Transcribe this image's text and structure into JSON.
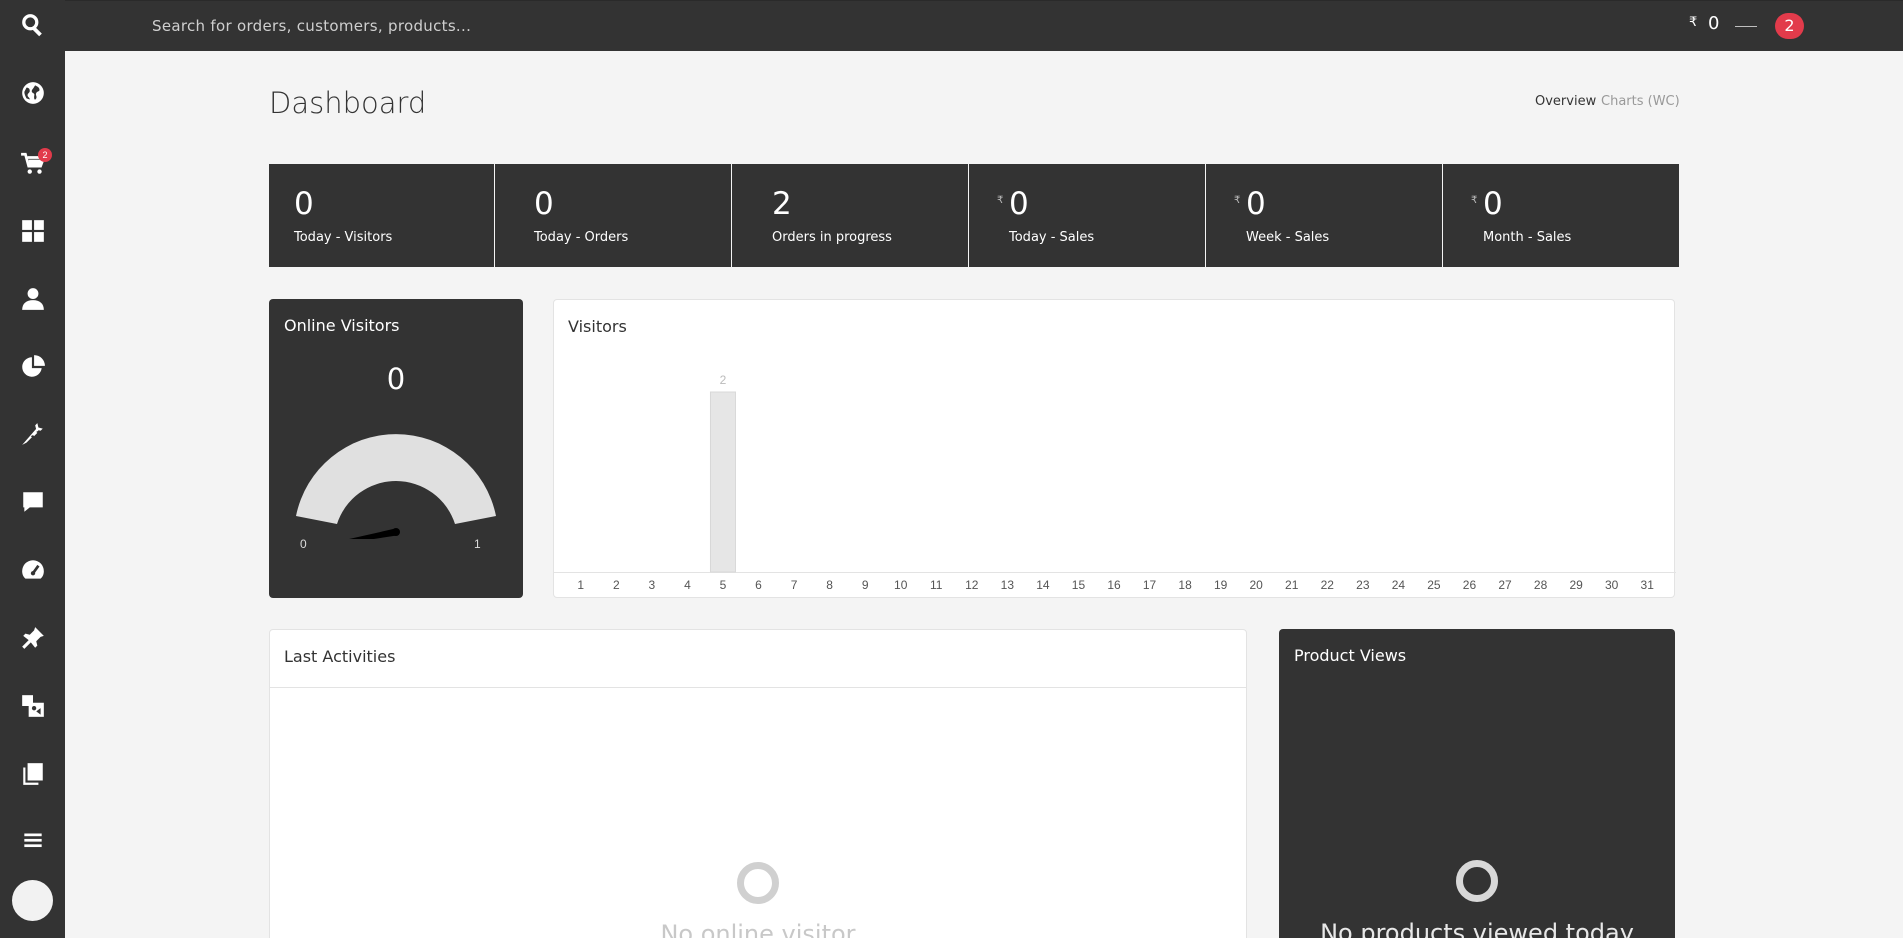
{
  "sidebar": {
    "items": [
      {
        "icon": "search-icon"
      },
      {
        "icon": "globe-icon"
      },
      {
        "icon": "cart-icon",
        "badge": "2"
      },
      {
        "icon": "dashboard-grid-icon"
      },
      {
        "icon": "user-icon"
      },
      {
        "icon": "pie-chart-icon"
      },
      {
        "icon": "carrot-icon"
      },
      {
        "icon": "comment-icon"
      },
      {
        "icon": "gauge-icon"
      },
      {
        "icon": "pin-icon"
      },
      {
        "icon": "video-pages-icon"
      },
      {
        "icon": "copy-icon"
      },
      {
        "icon": "menu-icon"
      }
    ]
  },
  "topbar": {
    "search_placeholder": "Search for orders, customers, products...",
    "currency": "₹",
    "amount": "0",
    "notifications": "2"
  },
  "header": {
    "title": "Dashboard",
    "tabs": [
      {
        "label": "Overview",
        "active": true
      },
      {
        "label": "Charts (WC)",
        "active": false
      }
    ]
  },
  "stats": [
    {
      "value": "0",
      "label": "Today - Visitors",
      "currency": ""
    },
    {
      "value": "0",
      "label": "Today - Orders",
      "currency": ""
    },
    {
      "value": "2",
      "label": "Orders in progress",
      "currency": ""
    },
    {
      "value": "0",
      "label": "Today - Sales",
      "currency": "₹"
    },
    {
      "value": "0",
      "label": "Week - Sales",
      "currency": "₹"
    },
    {
      "value": "0",
      "label": "Month - Sales",
      "currency": "₹"
    }
  ],
  "online_visitors": {
    "title": "Online Visitors",
    "count": "0",
    "gauge_min": "0",
    "gauge_max": "1",
    "gauge_value": 0
  },
  "visitors_card": {
    "title": "Visitors"
  },
  "chart_data": {
    "type": "bar",
    "categories": [
      "1",
      "2",
      "3",
      "4",
      "5",
      "6",
      "7",
      "8",
      "9",
      "10",
      "11",
      "12",
      "13",
      "14",
      "15",
      "16",
      "17",
      "18",
      "19",
      "20",
      "21",
      "22",
      "23",
      "24",
      "25",
      "26",
      "27",
      "28",
      "29",
      "30",
      "31"
    ],
    "values": [
      0,
      0,
      0,
      0,
      2,
      0,
      0,
      0,
      0,
      0,
      0,
      0,
      0,
      0,
      0,
      0,
      0,
      0,
      0,
      0,
      0,
      0,
      0,
      0,
      0,
      0,
      0,
      0,
      0,
      0,
      0
    ],
    "data_labels": {
      "5": "2"
    },
    "title": "Visitors",
    "ylim": [
      0,
      2
    ],
    "grid": false,
    "colors": {
      "bar": "#e6e6e6",
      "bar_stroke": "#d8d8d8",
      "label": "#bbbbbb"
    }
  },
  "last_activities": {
    "title": "Last Activities",
    "empty_text": "No online visitor"
  },
  "product_views": {
    "title": "Product Views",
    "empty_text": "No products viewed today"
  },
  "colors": {
    "dark": "#333333",
    "background": "#f4f4f4",
    "badge": "#e23b4b"
  }
}
